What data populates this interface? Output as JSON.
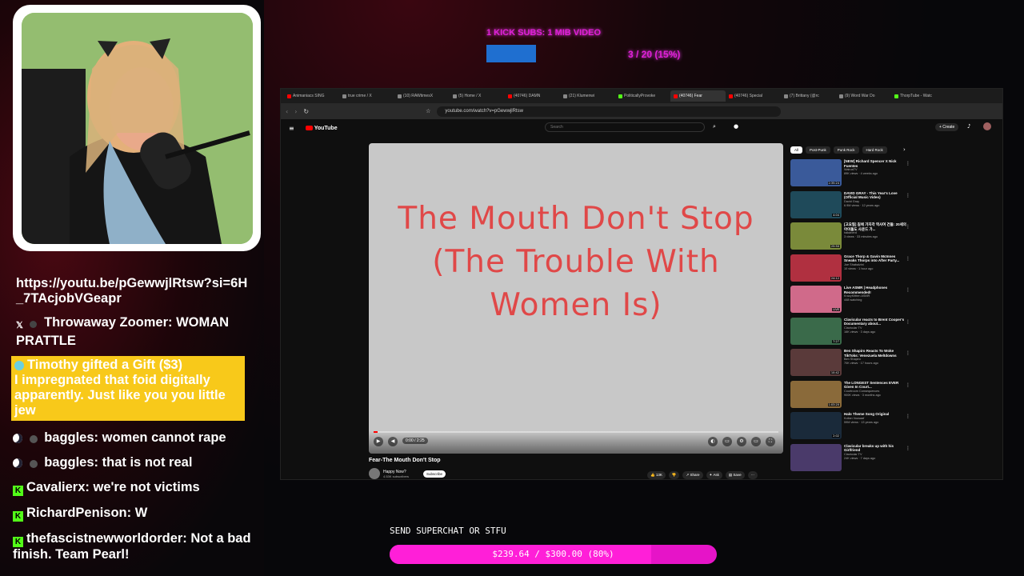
{
  "top_goal": {
    "label": "1 KICK SUBS: 1 MIB VIDEO",
    "count": "3 / 20 (15%)",
    "progress_fraction": 0.15
  },
  "chat": [
    {
      "type": "link",
      "text": "https://youtu.be/pGewwjlRtsw?si=6H_7TAcjobVGeapr"
    },
    {
      "type": "x",
      "icon": "x-icon",
      "user": "Throwaway Zoomer",
      "text": "WOMAN PRATTLE"
    },
    {
      "type": "gift",
      "icon": "gift-icon",
      "header": "Timothy gifted a Gift ($3)",
      "text": "I impregnated that foid digitally apparently. Just like you you little jew"
    },
    {
      "type": "moon",
      "icon": "moon-icon",
      "user": "baggles",
      "text": "women cannot rape"
    },
    {
      "type": "moon",
      "icon": "moon-icon",
      "user": "baggles",
      "text": "that is not real"
    },
    {
      "type": "kick",
      "icon": "kick-icon",
      "user": "Cavalierx",
      "text": "we're not victims"
    },
    {
      "type": "kick",
      "icon": "kick-icon",
      "user": "RichardPenison",
      "text": "W"
    },
    {
      "type": "kick",
      "icon": "kick-icon",
      "user": "thefascistnewworldorder",
      "text": "Not a bad finish. Team Pearl!"
    }
  ],
  "browser": {
    "tabs": [
      {
        "label": "Animaniacs SING",
        "color": "#ff0000"
      },
      {
        "label": "true crime / X",
        "color": "#888888"
      },
      {
        "label": "(10) RAWtimesX",
        "color": "#888888"
      },
      {
        "label": "(5) Home / X",
        "color": "#888888"
      },
      {
        "label": "(40746) DAMN",
        "color": "#ff0000"
      },
      {
        "label": "(21) Klumenwi",
        "color": "#888888"
      },
      {
        "label": "PoliticallyProvoke",
        "color": "#53fc18"
      },
      {
        "label": "(40746) Fear",
        "color": "#ff0000",
        "active": true
      },
      {
        "label": "(40746) Special",
        "color": "#ff0000"
      },
      {
        "label": "(7) Brittany (@rc",
        "color": "#888888"
      },
      {
        "label": "(9) Word War Do",
        "color": "#888888"
      },
      {
        "label": "ThorpTube - Watc",
        "color": "#53fc18"
      }
    ],
    "url": "youtube.com/watch?v=pGewwjlRtsw",
    "yt_logo": "YouTube",
    "search_placeholder": "Search",
    "create_label": "+ Create",
    "video_title_overlay": "The Mouth Don't Stop (The Trouble With Women Is)",
    "time": "0:00 / 2:25",
    "progress_fraction": 0.01,
    "video_name": "Fear-The Mouth Don't Stop",
    "channel_name": "Happy Now?",
    "channel_subs": "4.53K subscribers",
    "subscribe_label": "Subscribe",
    "actions": [
      "13K",
      "",
      "Share",
      "Ask",
      "Save",
      "···"
    ],
    "chips": [
      "All",
      "Post-Punk",
      "Punk Rock",
      "Hard Rock"
    ],
    "recommended": [
      {
        "title": "[NEW] Richard Spencer X Nick Fuentes",
        "channel": "WalrusTV",
        "meta": "89K views · 4 weeks ago",
        "duration": "2:35:24",
        "color": "#3a5a9a"
      },
      {
        "title": "DAVID GRAY - This Year's Love (Official Music Video)",
        "channel": "David Gray",
        "meta": "6.9M views · 12 years ago",
        "duration": "4:04",
        "color": "#1f4a5a"
      },
      {
        "title": "[고요질] 길에 가지각 역사여 건들: 20세의 아이돌도 사운드 가...",
        "channel": "hakanerd",
        "meta": "3 views · 33 minutes ago",
        "duration": "25:50",
        "color": "#7a8a3a"
      },
      {
        "title": "Grace Thorp & Gavin McInnes Sneaks Thorps into After Party...",
        "channel": "Joe Shabalzini",
        "meta": "10 views · 1 hour ago",
        "duration": "24:12",
        "color": "#b03040"
      },
      {
        "title": "Live ASMR | Headphones Recommended!",
        "channel": "KrazyKittten ASMR",
        "meta": "448 watching",
        "duration": "LIVE",
        "color": "#d06a8a"
      },
      {
        "title": "Clavicular reacts to Brent Cooper's Documentary about...",
        "channel": "Clavicular TV",
        "meta": "16K views · 3 days ago",
        "duration": "7:27",
        "color": "#3a6a4a"
      },
      {
        "title": "Ben Shapiro Reacts To Woke TikToks: Venezuela Meltdowns",
        "channel": "Ben Shapiro",
        "meta": "70K views · 17 hours ago",
        "duration": "10:42",
        "color": "#5a3a3a"
      },
      {
        "title": "The LONGEST Sentences EVER Given In Court...",
        "channel": "Courtroom Consequences",
        "meta": "900K views · 3 months ago",
        "duration": "1:03:20",
        "color": "#8a6a3a"
      },
      {
        "title": "Halo Theme Song Original",
        "channel": "Kollan Vousaaf",
        "meta": "59M views · 13 years ago",
        "duration": "2:02",
        "color": "#1a2a3a"
      },
      {
        "title": "Clavicular breaks up with his Girlfriend",
        "channel": "Clavicular TV",
        "meta": "24K views · 7 days ago",
        "duration": "",
        "color": "#4a3a6a"
      }
    ]
  },
  "bottom_goal": {
    "label": "SEND SUPERCHAT OR STFU",
    "text": "$239.64 / $300.00 (80%)",
    "progress_fraction": 0.8
  }
}
